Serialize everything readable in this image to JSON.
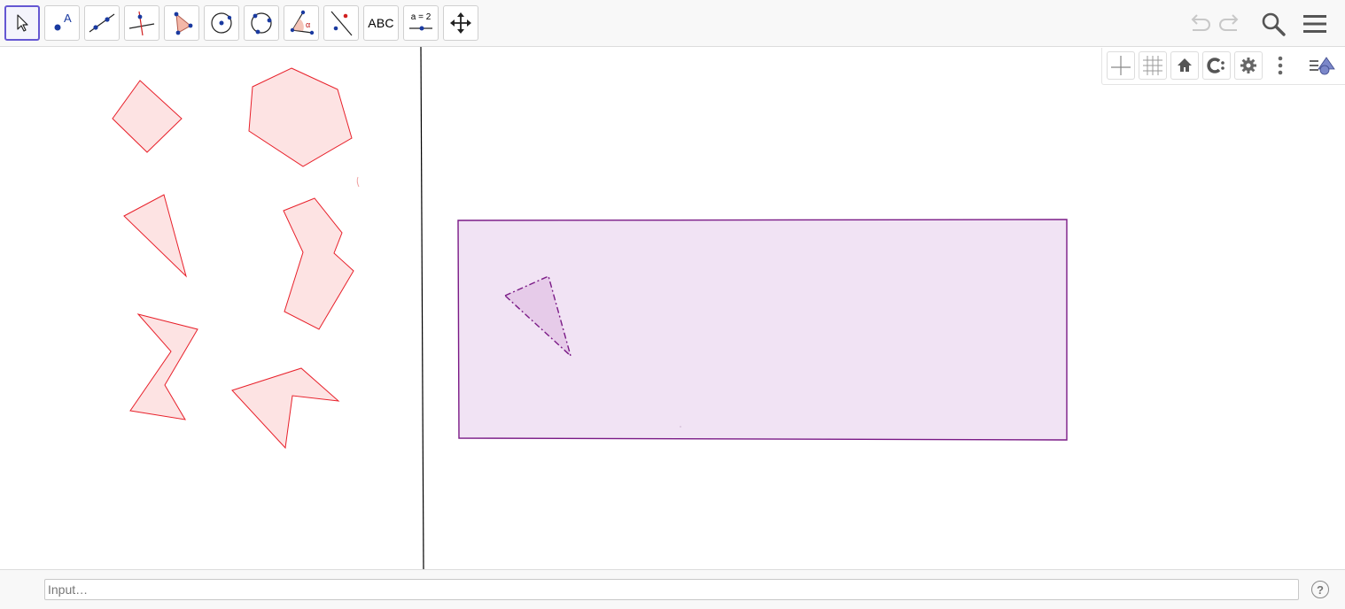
{
  "toolbar": {
    "tools": [
      {
        "name": "move-tool",
        "icon": "cursor-arrow-icon"
      },
      {
        "name": "point-tool",
        "icon": "point-a-icon",
        "label": "A"
      },
      {
        "name": "line-tool",
        "icon": "line-through-points-icon"
      },
      {
        "name": "perpendicular-line-tool",
        "icon": "perpendicular-line-icon"
      },
      {
        "name": "polygon-tool",
        "icon": "polygon-icon"
      },
      {
        "name": "circle-center-point-tool",
        "icon": "circle-center-icon"
      },
      {
        "name": "circle-three-points-tool",
        "icon": "circle-three-points-icon"
      },
      {
        "name": "angle-tool",
        "icon": "angle-icon",
        "label": "α"
      },
      {
        "name": "reflect-line-tool",
        "icon": "reflect-line-icon"
      },
      {
        "name": "text-tool",
        "icon": "text-abc-icon",
        "label": "ABC"
      },
      {
        "name": "slider-tool",
        "icon": "slider-icon",
        "label": "a = 2"
      },
      {
        "name": "move-graphics-tool",
        "icon": "move-graphics-icon"
      }
    ],
    "selected_tool": "move-tool"
  },
  "topright": {
    "undo_icon": "undo-icon",
    "redo_icon": "redo-icon",
    "search_icon": "search-icon",
    "menu_icon": "hamburger-menu-icon"
  },
  "stylebar": {
    "buttons": [
      "axes-icon",
      "grid-icon",
      "home-icon",
      "point-capturing-icon",
      "settings-gear-icon",
      "more-vertical-icon",
      "graphics-view-toggle-icon"
    ]
  },
  "colors": {
    "accent": "#6557d2",
    "red_stroke": "#e8202a",
    "red_fill": "#fde3e3",
    "purple_stroke": "#7a1a86",
    "purple_fill": "#f1e3f4",
    "triangle_fill": "#e6cbe9"
  },
  "input_bar": {
    "placeholder": "Input…",
    "help_icon": "help-icon",
    "help_label": "?"
  }
}
